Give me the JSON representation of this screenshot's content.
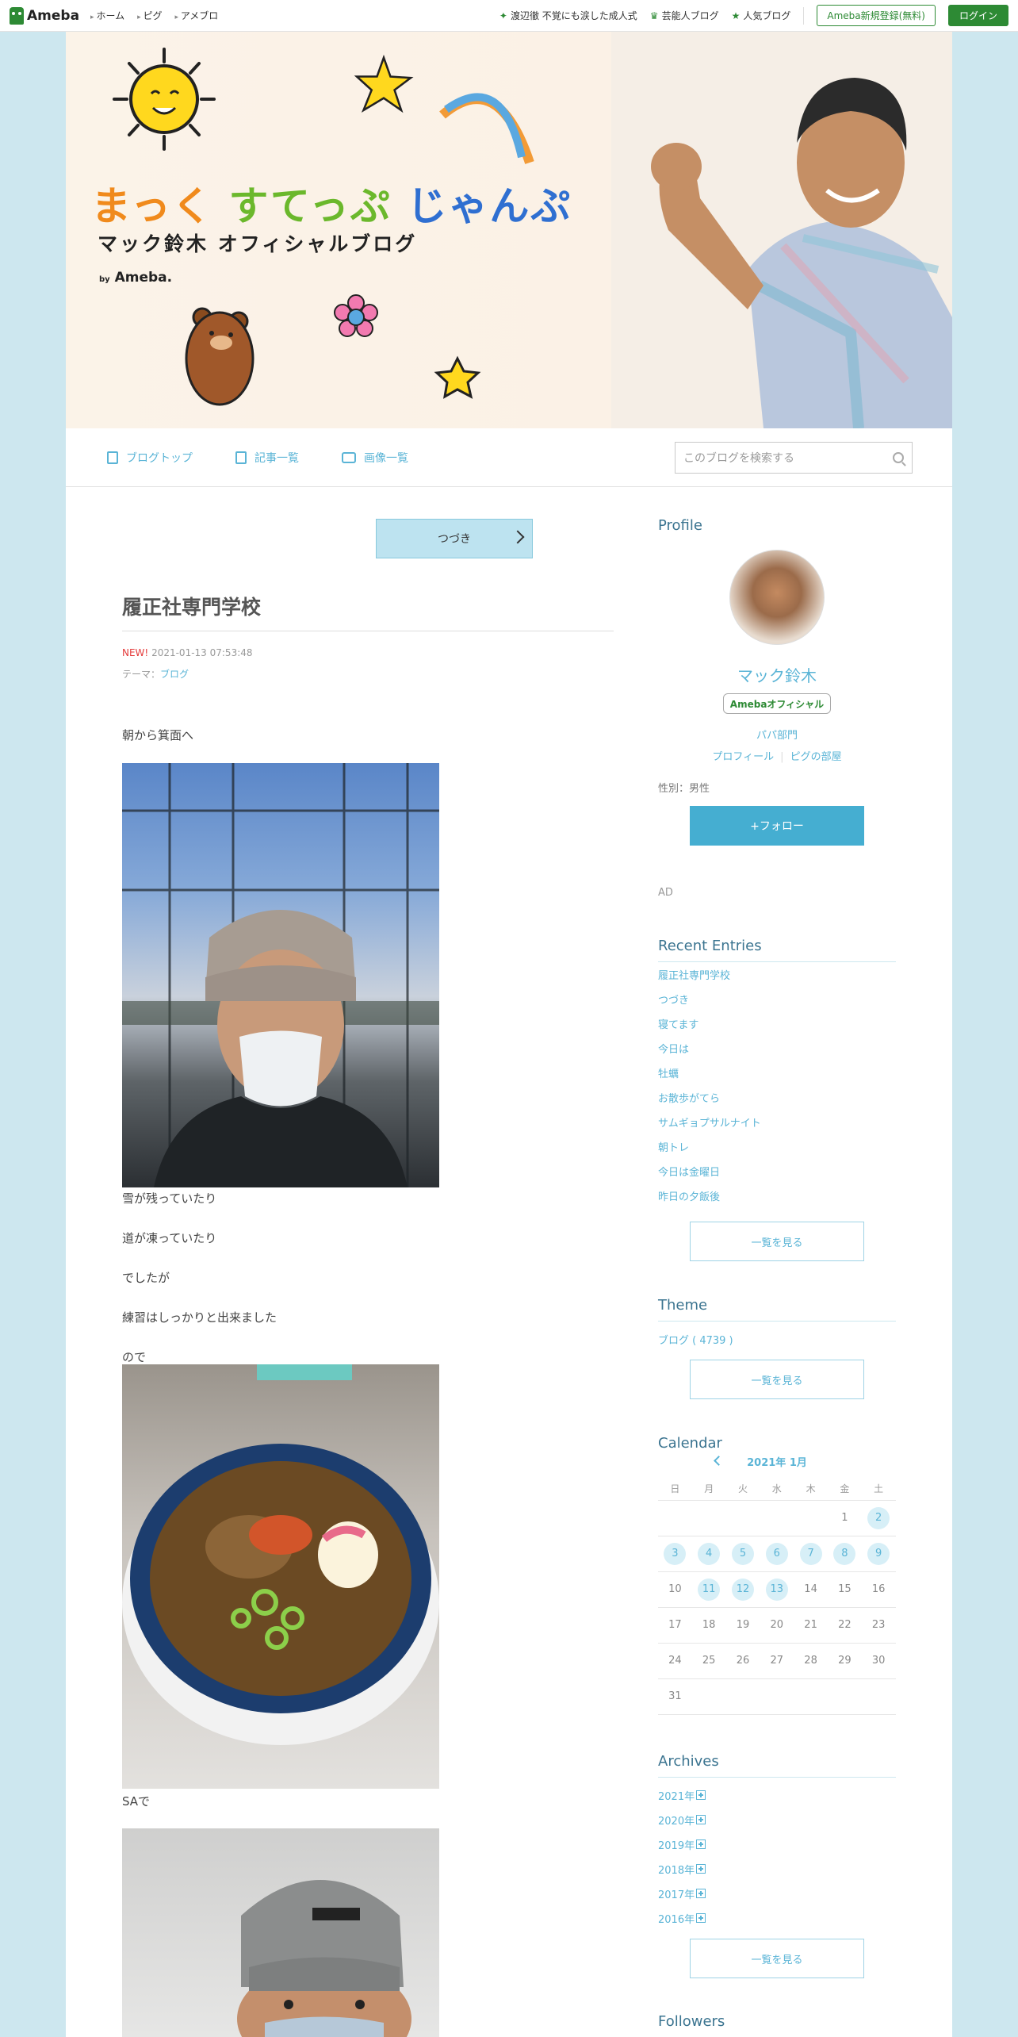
{
  "global_header": {
    "logo": "Ameba",
    "nav": [
      "ホーム",
      "ピグ",
      "アメブロ"
    ],
    "links": [
      "渡辺徹 不覚にも涙した成人式",
      "芸能人ブログ",
      "人気ブログ"
    ],
    "register": "Ameba新規登録(無料)",
    "login": "ログイン"
  },
  "banner": {
    "title_part1": "まっく",
    "title_part2": "すてっぷ",
    "title_part3": "じゃんぷ",
    "subtitle": "マック鈴木 オフィシャルブログ",
    "by_prefix": "by",
    "by_brand": "Ameba."
  },
  "blog_nav": {
    "items": [
      "ブログトップ",
      "記事一覧",
      "画像一覧"
    ],
    "search_placeholder": "このブログを検索する"
  },
  "post": {
    "continue_label": "つづき",
    "title": "履正社専門学校",
    "new_badge": "NEW!",
    "datetime": "2021-01-13 07:53:48",
    "theme_prefix": "テーマ：",
    "theme": "ブログ",
    "lines": [
      "朝から箕面へ",
      "雪が残っていたり",
      "道が凍っていたり",
      "でしたが",
      "練習はしっかりと出来ました",
      "ので",
      "SAで"
    ]
  },
  "sidebar": {
    "profile_heading": "Profile",
    "name": "マック鈴木",
    "badge": "Amebaオフィシャル",
    "category": "パパ部門",
    "profile_link": "プロフィール",
    "room_link": "ピグの部屋",
    "gender": "性別：男性",
    "follow_label": "+フォロー",
    "ad_label": "AD",
    "recent_heading": "Recent Entries",
    "recent_entries": [
      "履正社専門学校",
      "つづき",
      "寝てます",
      "今日は",
      "牡蠣",
      "お散歩がてら",
      "サムギョプサルナイト",
      "朝トレ",
      "今日は金曜日",
      "昨日の夕飯後"
    ],
    "see_all": "一覧を見る",
    "theme_heading": "Theme",
    "theme_item": "ブログ ( 4739 )",
    "calendar_heading": "Calendar",
    "calendar_month": "2021年 1月",
    "weekdays": [
      "日",
      "月",
      "火",
      "水",
      "木",
      "金",
      "土"
    ],
    "calendar_rows": [
      [
        "",
        "",
        "",
        "",
        "",
        "1",
        "2"
      ],
      [
        "3",
        "4",
        "5",
        "6",
        "7",
        "8",
        "9"
      ],
      [
        "10",
        "11",
        "12",
        "13",
        "14",
        "15",
        "16"
      ],
      [
        "17",
        "18",
        "19",
        "20",
        "21",
        "22",
        "23"
      ],
      [
        "24",
        "25",
        "26",
        "27",
        "28",
        "29",
        "30"
      ],
      [
        "31",
        "",
        "",
        "",
        "",
        "",
        ""
      ]
    ],
    "calendar_active_days": [
      "2",
      "3",
      "4",
      "5",
      "6",
      "7",
      "8",
      "9",
      "11",
      "12",
      "13"
    ],
    "archives_heading": "Archives",
    "archives": [
      "2021年",
      "2020年",
      "2019年",
      "2018年",
      "2017年",
      "2016年"
    ],
    "followers_heading": "Followers"
  },
  "colors": {
    "background": "#cde7ef",
    "ameba_green": "#2d8a34",
    "accent_blue": "#5ab4d6",
    "follow_button": "#45aed1"
  }
}
